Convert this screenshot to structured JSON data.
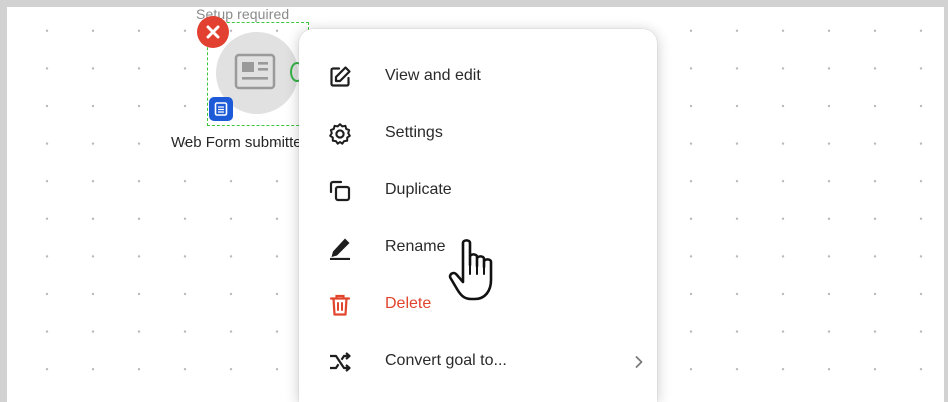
{
  "node": {
    "status_label": "Setup required",
    "title": "Web Form submitted"
  },
  "context_menu": {
    "items": [
      {
        "label": "View and edit",
        "icon": "edit-icon"
      },
      {
        "label": "Settings",
        "icon": "gear-icon"
      },
      {
        "label": "Duplicate",
        "icon": "duplicate-icon"
      },
      {
        "label": "Rename",
        "icon": "pencil-icon"
      },
      {
        "label": "Delete",
        "icon": "trash-icon",
        "color": "#e2452e"
      },
      {
        "label": "Convert goal to...",
        "icon": "shuffle-icon",
        "has_submenu": true
      }
    ]
  },
  "colors": {
    "error": "#e24030",
    "accent_blue": "#1c5ad8",
    "connector_green": "#37b34a",
    "danger": "#e2452e"
  }
}
